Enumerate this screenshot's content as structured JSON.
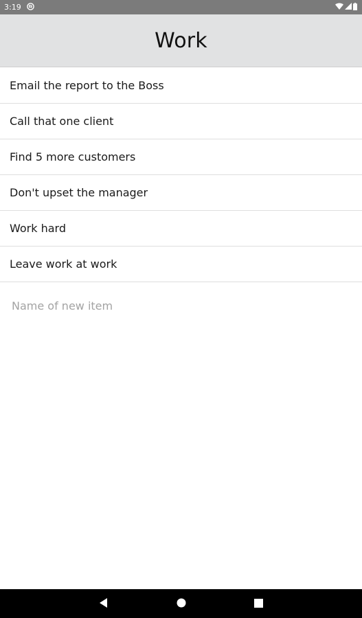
{
  "status_bar": {
    "time": "3:19"
  },
  "app_bar": {
    "title": "Work"
  },
  "items": [
    {
      "label": "Email the report to the Boss"
    },
    {
      "label": "Call that one client"
    },
    {
      "label": "Find 5 more customers"
    },
    {
      "label": "Don't upset the manager"
    },
    {
      "label": "Work hard"
    },
    {
      "label": "Leave work at work"
    }
  ],
  "new_item": {
    "placeholder": "Name of new item",
    "value": ""
  },
  "icons": {
    "status_notification": "app-notification-icon",
    "wifi": "wifi-icon",
    "cellular": "cellular-signal-icon",
    "battery": "battery-icon",
    "back": "back-triangle-icon",
    "home": "home-circle-icon",
    "recents": "recents-square-icon"
  },
  "colors": {
    "status_bar": "#7b7b7b",
    "app_bar": "#e1e2e3",
    "nav_bar": "#000000",
    "divider": "#dedede",
    "placeholder": "#a3a3a3"
  }
}
